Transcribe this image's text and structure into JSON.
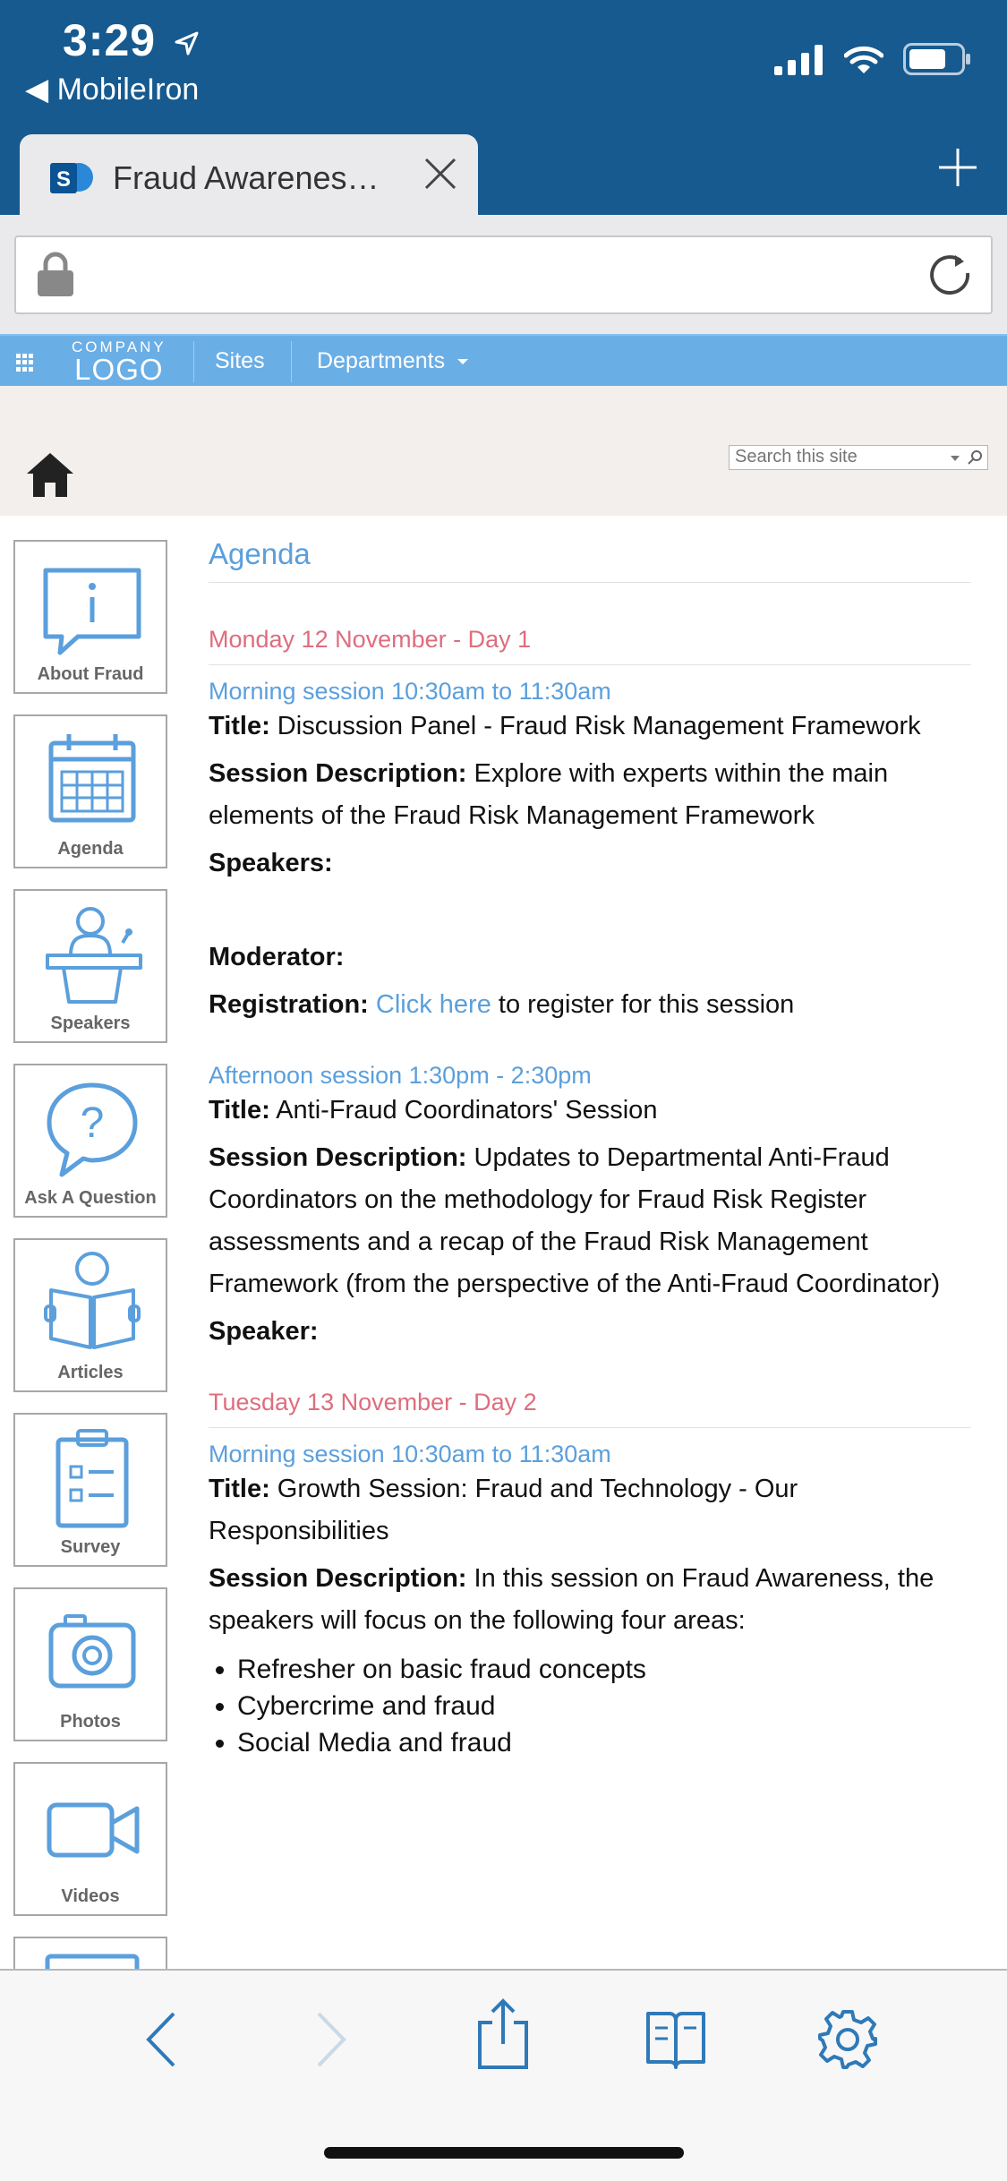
{
  "status": {
    "time": "3:29",
    "back_app": "◀ MobileIron"
  },
  "browser": {
    "tab_title": "Fraud Awarenes…",
    "url": ""
  },
  "nav": {
    "logo_top": "COMPANY",
    "logo_bottom": "LOGO",
    "sites": "Sites",
    "departments": "Departments"
  },
  "search": {
    "placeholder": "Search this site"
  },
  "tiles": [
    {
      "label": "About Fraud",
      "icon": "info-bubble-icon"
    },
    {
      "label": "Agenda",
      "icon": "calendar-icon"
    },
    {
      "label": "Speakers",
      "icon": "podium-speaker-icon"
    },
    {
      "label": "Ask A Question",
      "icon": "question-bubble-icon"
    },
    {
      "label": "Articles",
      "icon": "reader-book-icon"
    },
    {
      "label": "Survey",
      "icon": "clipboard-icon"
    },
    {
      "label": "Photos",
      "icon": "camera-icon"
    },
    {
      "label": "Videos",
      "icon": "video-camera-icon"
    }
  ],
  "agenda": {
    "heading": "Agenda",
    "day1": {
      "title": "Monday 12 November - Day 1",
      "morning": {
        "session": "Morning session 10:30am to 11:30am",
        "title_label": "Title:",
        "title": " Discussion Panel - Fraud Risk Management Framework",
        "desc_label": "Session Description:",
        "desc": " Explore with experts within the main elements of the Fraud Risk Management Framework",
        "speakers_label": "Speakers:",
        "moderator_label": "Moderator:",
        "registration_label": "Registration:",
        "registration_link": "Click here",
        "registration_text": " to register for this session"
      },
      "afternoon": {
        "session": "Afternoon session 1:30pm - 2:30pm",
        "title_label": "Title:",
        "title": " Anti-Fraud Coordinators' Session",
        "desc_label": "Session Description:",
        "desc": " Updates to Departmental Anti-Fraud Coordinators on the methodology for Fraud Risk Register assessments and a recap of the Fraud Risk Management Framework (from the perspective of the Anti-Fraud Coordinator)",
        "speaker_label": "Speaker:"
      }
    },
    "day2": {
      "title": "Tuesday 13 November - Day 2",
      "morning": {
        "session": "Morning session 10:30am to 11:30am",
        "title_label": "Title:",
        "title": " Growth Session: Fraud and Technology - Our Responsibilities",
        "desc_label": "Session Description:",
        "desc": " In this session on Fraud Awareness, the speakers will focus on the following four areas:",
        "areas": [
          "Refresher on basic fraud concepts",
          "Cybercrime and fraud",
          "Social Media and fraud"
        ]
      }
    }
  },
  "colors": {
    "status_bar": "#165a8f",
    "nav_bar": "#6aaee6",
    "accent_blue": "#5b9fdc",
    "day_red": "#de6d7e"
  }
}
